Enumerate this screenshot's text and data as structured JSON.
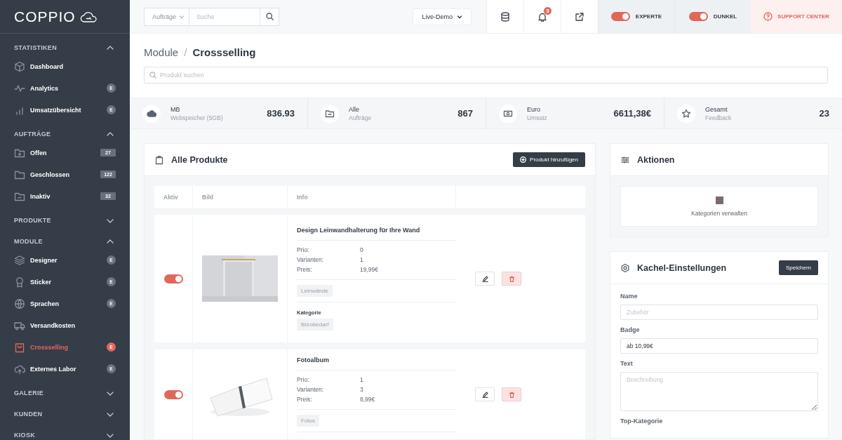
{
  "logo": {
    "text": "COPPIO"
  },
  "sidebar": {
    "sections": [
      {
        "title": "STATISTIKEN",
        "expanded": true,
        "items": [
          {
            "label": "Dashboard",
            "selected": false
          },
          {
            "label": "Analytics",
            "selected": false,
            "badge": {
              "text": "E",
              "kind": "letter"
            }
          },
          {
            "label": "Umsatzübersicht",
            "selected": false,
            "badge": {
              "text": "E",
              "kind": "letter"
            }
          }
        ]
      },
      {
        "title": "AUFTRÄGE",
        "expanded": true,
        "items": [
          {
            "label": "Offen",
            "selected": false,
            "badge": {
              "text": "27",
              "kind": "count"
            }
          },
          {
            "label": "Geschlossen",
            "selected": false,
            "badge": {
              "text": "122",
              "kind": "count"
            }
          },
          {
            "label": "Inaktiv",
            "selected": false,
            "badge": {
              "text": "32",
              "kind": "count"
            }
          }
        ]
      },
      {
        "title": "PRODUKTE",
        "expanded": false
      },
      {
        "title": "MODULE",
        "expanded": true,
        "items": [
          {
            "label": "Designer",
            "selected": false,
            "badge": {
              "text": "E",
              "kind": "letter"
            }
          },
          {
            "label": "Sticker",
            "selected": false,
            "badge": {
              "text": "E",
              "kind": "letter"
            }
          },
          {
            "label": "Sprachen",
            "selected": false,
            "badge": {
              "text": "E",
              "kind": "letter"
            }
          },
          {
            "label": "Versandkosten",
            "selected": false
          },
          {
            "label": "Crossselling",
            "selected": true,
            "badge": {
              "text": "E",
              "kind": "letter"
            }
          },
          {
            "label": "Externes Labor",
            "selected": false,
            "badge": {
              "text": "E",
              "kind": "letter"
            }
          }
        ]
      },
      {
        "title": "GALERIE",
        "expanded": false
      },
      {
        "title": "KUNDEN",
        "expanded": false
      },
      {
        "title": "KIOSK",
        "expanded": false
      }
    ]
  },
  "topbar": {
    "search_scope": "Aufträge",
    "search": {
      "placeholder": "Suche"
    },
    "demo": "Live-Demo",
    "notifications": "3",
    "toggles": [
      {
        "label": "EXPERTE",
        "on": true
      },
      {
        "label": "DUNKEL",
        "on": true
      }
    ],
    "support": "SUPPORT CENTER"
  },
  "breadcrumb": [
    "Module",
    "/",
    "Crossselling"
  ],
  "product_search": {
    "placeholder": "Produkt suchen"
  },
  "stats": [
    {
      "unit": "MB",
      "label": "Webspeicher (5GB)",
      "value": "836.93"
    },
    {
      "unit": "Alle",
      "label": "Aufträge",
      "value": "867"
    },
    {
      "unit": "Euro",
      "label": "Umsatz",
      "value": "6611,38€"
    },
    {
      "unit": "Gesamt",
      "label": "Feedback",
      "value": "23"
    }
  ],
  "products": {
    "title": "Alle Produkte",
    "add_button": "Produkt hinzufügen",
    "columns": [
      "Aktiv",
      "Bild",
      "Info"
    ],
    "rows": [
      {
        "active": true,
        "name": "Design Leinwandhalterung für Ihre Wand",
        "fields": [
          {
            "label": "Prio:",
            "value": "0"
          },
          {
            "label": "Varianten:",
            "value": "1"
          },
          {
            "label": "Preis:",
            "value": "19,99€"
          }
        ],
        "tag": "Leinwände",
        "category_label": "Kategorie",
        "category": "Bürobedarf"
      },
      {
        "active": true,
        "name": "Fotoalbum",
        "fields": [
          {
            "label": "Prio:",
            "value": "1"
          },
          {
            "label": "Varianten:",
            "value": "3"
          },
          {
            "label": "Preis:",
            "value": "8,99€"
          }
        ],
        "tag": "Fotos"
      }
    ]
  },
  "actions": {
    "title": "Aktionen",
    "items": [
      "Kategorien verwalten"
    ]
  },
  "tile_settings": {
    "title": "Kachel-Einstellungen",
    "save_button": "Speichern",
    "fields": [
      {
        "label": "Name",
        "kind": "input",
        "placeholder": "Zubehör"
      },
      {
        "label": "Badge",
        "kind": "input",
        "value": "ab 10,99€"
      },
      {
        "label": "Text",
        "kind": "textarea",
        "placeholder": "Beschreibung"
      },
      {
        "label": "Top-Kategorie",
        "kind": "label"
      }
    ]
  }
}
